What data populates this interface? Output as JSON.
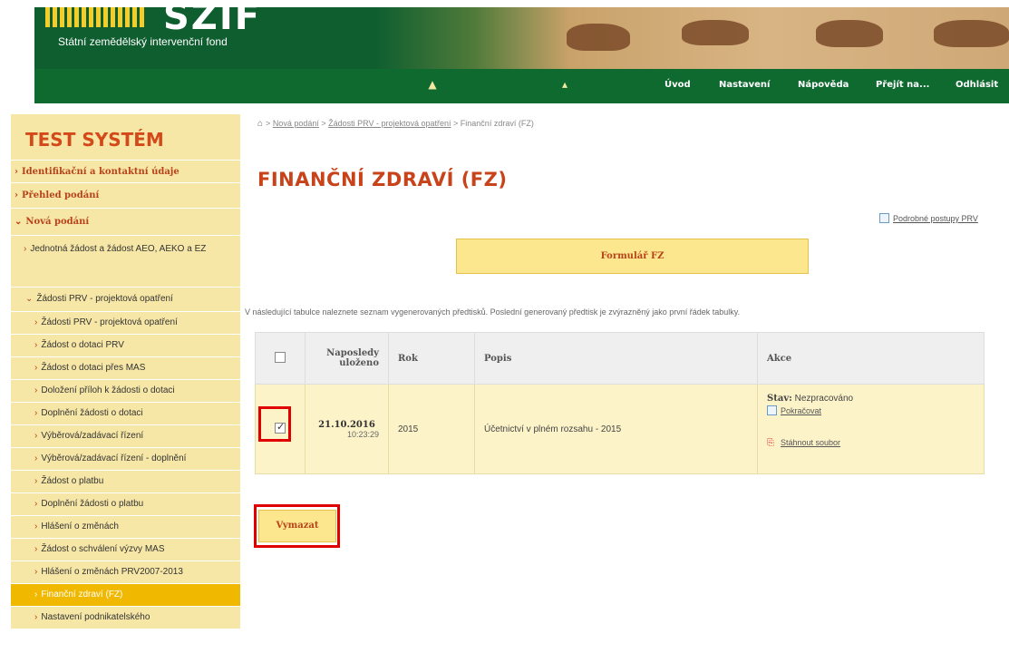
{
  "header": {
    "logo_text": "SZIF",
    "subtitle": "Státní zemědělský intervenční fond",
    "nav": [
      "Úvod",
      "Nastavení",
      "Nápověda",
      "Přejít na...",
      "Odhlásit"
    ]
  },
  "sidebar": {
    "title": "TEST SYSTÉM",
    "items": [
      {
        "label": "Identifikační a kontaktní údaje",
        "level": 1
      },
      {
        "label": "Přehled podání",
        "level": 1
      },
      {
        "label": "Nová podání",
        "level": 1
      },
      {
        "label": "Jednotná žádost a žádost AEO, AEKO a EZ",
        "level": 2
      },
      {
        "label": "Žádosti PRV - projektová opatření",
        "level": 2
      },
      {
        "label": "Žádosti PRV - projektová opatření",
        "level": 3
      },
      {
        "label": "Žádost o dotaci PRV",
        "level": 3
      },
      {
        "label": "Žádost o dotaci přes MAS",
        "level": 3
      },
      {
        "label": "Doložení příloh k žádosti o dotaci",
        "level": 3
      },
      {
        "label": "Doplnění žádosti o dotaci",
        "level": 3
      },
      {
        "label": "Výběrová/zadávací řízení",
        "level": 3
      },
      {
        "label": "Výběrová/zadávací řízení - doplnění",
        "level": 3
      },
      {
        "label": "Žádost o platbu",
        "level": 3
      },
      {
        "label": "Doplnění žádosti o platbu",
        "level": 3
      },
      {
        "label": "Hlášení o změnách",
        "level": 3
      },
      {
        "label": "Žádost o schválení výzvy MAS",
        "level": 3
      },
      {
        "label": "Hlášení o změnách PRV2007-2013",
        "level": 3
      },
      {
        "label": "Finanční zdraví (FZ)",
        "level": 3,
        "active": true
      },
      {
        "label": "Nastavení podnikatelského",
        "level": 3
      }
    ]
  },
  "breadcrumb": {
    "items": [
      "Nová podání",
      "Žádosti PRV - projektová opatření"
    ],
    "current": "Finanční zdraví (FZ)"
  },
  "main": {
    "title": "FINANČNÍ ZDRAVÍ (FZ)",
    "procedures_link": "Podrobné postupy PRV",
    "form_button": "Formulář FZ",
    "intro_text": "V následující tabulce naleznete seznam vygenerovaných předtisků. Poslední generovaný předtisk je zvýrazněný jako první řádek tabulky.",
    "table": {
      "headers": [
        "",
        "Naposledy uloženo",
        "Rok",
        "Popis",
        "Akce"
      ],
      "rows": [
        {
          "checked": true,
          "saved_date": "21.10.2016",
          "saved_time": "10:23:29",
          "year": "2015",
          "description": "Účetnictví v plném rozsahu - 2015",
          "status_label": "Stav:",
          "status_value": "Nezpracováno",
          "continue_link": "Pokračovat",
          "download_link": "Stáhnout soubor"
        }
      ]
    },
    "delete_button": "Vymazat"
  },
  "colors": {
    "brand_green": "#0f6a30",
    "brand_yellow": "#f7e7a6",
    "accent_orange": "#c8431a",
    "highlight_red": "#e00000"
  }
}
